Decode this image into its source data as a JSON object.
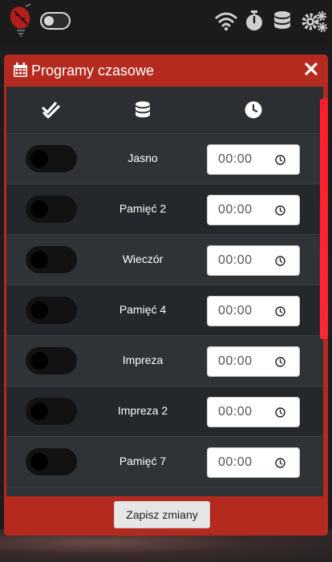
{
  "topbar": {
    "logo_icon": "ladybug-lamp-logo",
    "icons": [
      "wifi-icon",
      "stopwatch-icon",
      "database-icon",
      "gears-icon"
    ]
  },
  "modal": {
    "title": "Programy czasowe",
    "close_icon": "close-icon",
    "header_columns": [
      "check-double-icon",
      "database-icon",
      "clock-icon"
    ],
    "rows": [
      {
        "enabled": false,
        "label": "Jasno",
        "time": "00:00"
      },
      {
        "enabled": false,
        "label": "Pamięć 2",
        "time": "00:00"
      },
      {
        "enabled": false,
        "label": "Wieczór",
        "time": "00:00"
      },
      {
        "enabled": false,
        "label": "Pamięć 4",
        "time": "00:00"
      },
      {
        "enabled": false,
        "label": "Impreza",
        "time": "00:00"
      },
      {
        "enabled": false,
        "label": "Impreza 2",
        "time": "00:00"
      },
      {
        "enabled": false,
        "label": "Pamięć 7",
        "time": "00:00"
      }
    ],
    "save_label": "Zapisz zmiany"
  },
  "colors": {
    "accent": "#b42a1f",
    "scrollbar": "#ff1d2b",
    "table_bg": "#2e3136"
  }
}
